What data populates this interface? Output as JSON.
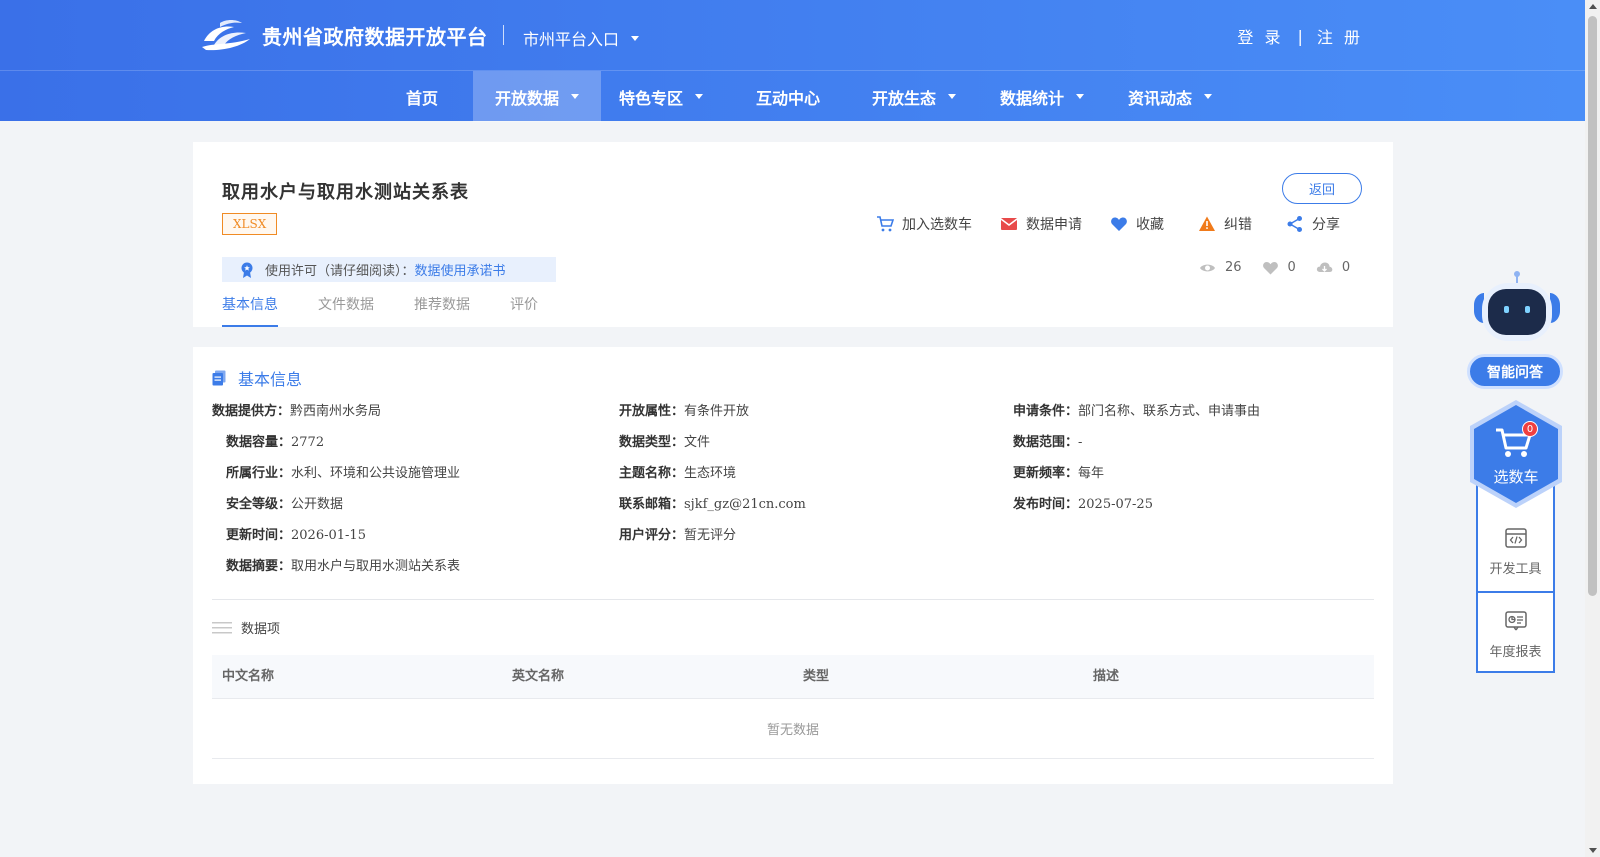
{
  "header": {
    "site_title": "贵州省政府数据开放平台",
    "city_entry": "市州平台入口",
    "login": "登 录",
    "separator": "|",
    "register": "注 册"
  },
  "nav": {
    "items": [
      {
        "label": "首页",
        "dropdown": false,
        "active": false
      },
      {
        "label": "开放数据",
        "dropdown": true,
        "active": true
      },
      {
        "label": "特色专区",
        "dropdown": true,
        "active": false
      },
      {
        "label": "互动中心",
        "dropdown": false,
        "active": false
      },
      {
        "label": "开放生态",
        "dropdown": true,
        "active": false
      },
      {
        "label": "数据统计",
        "dropdown": true,
        "active": false
      },
      {
        "label": "资讯动态",
        "dropdown": true,
        "active": false
      }
    ]
  },
  "dataset": {
    "title": "取用水户与取用水测站关系表",
    "format": "XLSX",
    "back_label": "返回",
    "actions": [
      {
        "label": "加入选数车",
        "icon": "cart-icon"
      },
      {
        "label": "数据申请",
        "icon": "mail-icon"
      },
      {
        "label": "收藏",
        "icon": "heart-icon"
      },
      {
        "label": "纠错",
        "icon": "warning-icon"
      },
      {
        "label": "分享",
        "icon": "share-icon"
      }
    ],
    "license_text": "使用许可（请仔细阅读）：",
    "license_link": "数据使用承诺书",
    "stats": {
      "views": "26",
      "likes": "0",
      "downloads": "0"
    },
    "tabs": [
      "基本信息",
      "文件数据",
      "推荐数据",
      "评价"
    ]
  },
  "basic_info": {
    "section_title": "基本信息",
    "fields": [
      {
        "label": "数据提供方：",
        "value": "黔西南州水务局"
      },
      {
        "label": "开放属性：",
        "value": "有条件开放"
      },
      {
        "label": "申请条件：",
        "value": "部门名称、联系方式、申请事由"
      },
      {
        "label": "数据容量：",
        "value": "2772"
      },
      {
        "label": "数据类型：",
        "value": "文件"
      },
      {
        "label": "数据范围：",
        "value": "-"
      },
      {
        "label": "所属行业：",
        "value": "水利、环境和公共设施管理业"
      },
      {
        "label": "主题名称：",
        "value": "生态环境"
      },
      {
        "label": "更新频率：",
        "value": "每年"
      },
      {
        "label": "安全等级：",
        "value": "公开数据"
      },
      {
        "label": "联系邮箱：",
        "value": "sjkf_gz@21cn.com"
      },
      {
        "label": "发布时间：",
        "value": "2025-07-25"
      },
      {
        "label": "更新时间：",
        "value": "2026-01-15"
      },
      {
        "label": "用户评分：",
        "value": "暂无评分"
      },
      {
        "label": "数据摘要：",
        "value": "取用水户与取用水测站关系表"
      }
    ]
  },
  "data_items": {
    "title": "数据项",
    "columns": [
      "中文名称",
      "英文名称",
      "类型",
      "描述"
    ],
    "empty_text": "暂无数据"
  },
  "side": {
    "qa_label": "智能问答",
    "cart_label": "选数车",
    "cart_count": "0",
    "dev_tools_label": "开发工具",
    "annual_report_label": "年度报表"
  },
  "colors": {
    "primary": "#3c7ce8",
    "header_start": "#3a70e8",
    "header_end": "#4a8ef7",
    "badge_orange": "#f08b24",
    "mail_red": "#e84a4a",
    "warning_orange": "#f07a1a"
  }
}
